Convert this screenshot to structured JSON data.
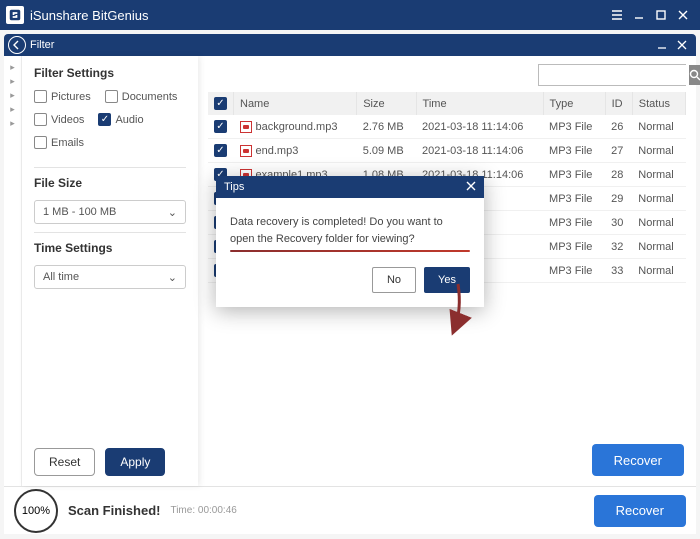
{
  "app": {
    "title": "iSunshare BitGenius"
  },
  "filterbar": {
    "label": "Filter"
  },
  "sidebar": {
    "settings_title": "Filter Settings",
    "chk_pictures": "Pictures",
    "chk_documents": "Documents",
    "chk_videos": "Videos",
    "chk_audio": "Audio",
    "chk_emails": "Emails",
    "filesize_title": "File Size",
    "filesize_value": "1 MB - 100 MB",
    "time_title": "Time Settings",
    "time_value": "All time",
    "reset": "Reset",
    "apply": "Apply"
  },
  "search": {
    "placeholder": ""
  },
  "table": {
    "cols": {
      "name": "Name",
      "size": "Size",
      "time": "Time",
      "type": "Type",
      "id": "ID",
      "status": "Status"
    },
    "rows": [
      {
        "name": "background.mp3",
        "size": "2.76 MB",
        "time": "2021-03-18 11:14:06",
        "type": "MP3 File",
        "id": "26",
        "status": "Normal"
      },
      {
        "name": "end.mp3",
        "size": "5.09 MB",
        "time": "2021-03-18 11:14:06",
        "type": "MP3 File",
        "id": "27",
        "status": "Normal"
      },
      {
        "name": "example1.mp3",
        "size": "1.08 MB",
        "time": "2021-03-18 11:14:06",
        "type": "MP3 File",
        "id": "28",
        "status": "Normal"
      },
      {
        "name": "",
        "size": "",
        "time": "6",
        "type": "MP3 File",
        "id": "29",
        "status": "Normal"
      },
      {
        "name": "",
        "size": "",
        "time": "6",
        "type": "MP3 File",
        "id": "30",
        "status": "Normal"
      },
      {
        "name": "",
        "size": "",
        "time": "6",
        "type": "MP3 File",
        "id": "32",
        "status": "Normal"
      },
      {
        "name": "",
        "size": "",
        "time": "6",
        "type": "MP3 File",
        "id": "33",
        "status": "Normal"
      }
    ]
  },
  "recover": "Recover",
  "footer": {
    "percent": "100%",
    "status": "Scan Finished!",
    "time_label": "Time:",
    "time_value": "00:00:46",
    "recover": "Recover"
  },
  "dialog": {
    "title": "Tips",
    "message": "Data recovery is completed! Do you want to open the Recovery folder for viewing?",
    "no": "No",
    "yes": "Yes"
  }
}
